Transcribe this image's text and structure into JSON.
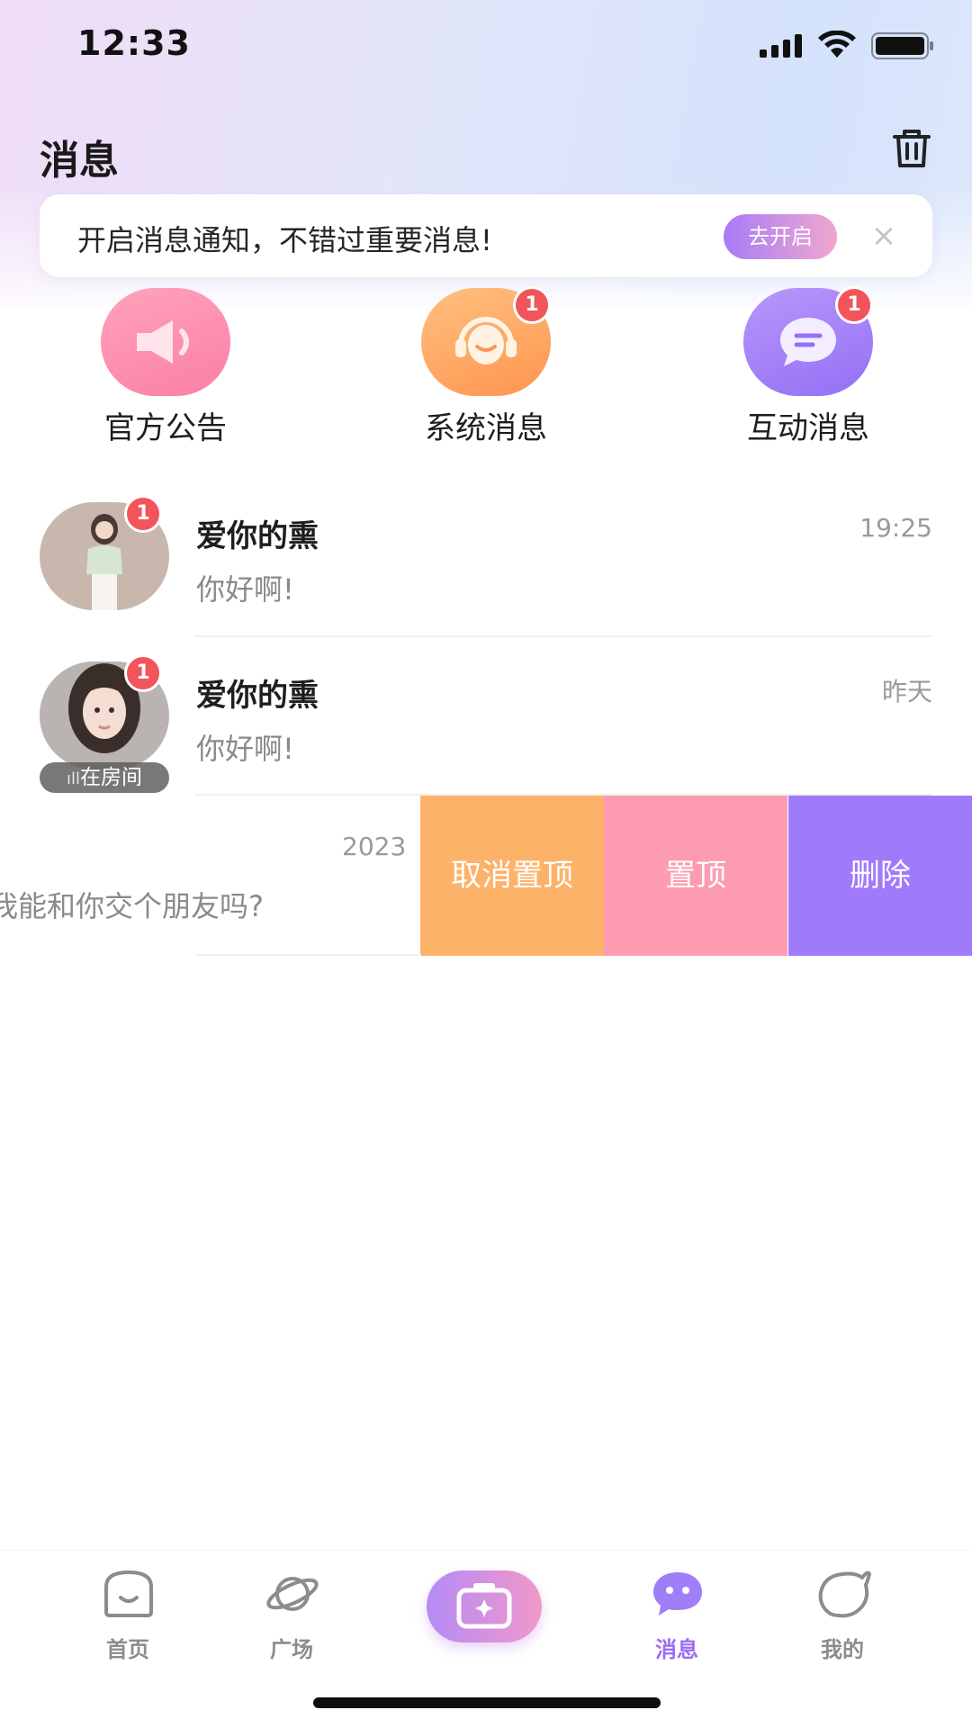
{
  "status_bar": {
    "time": "12:33"
  },
  "header": {
    "title": "消息"
  },
  "notification_banner": {
    "text": "开启消息通知，不错过重要消息!",
    "button_label": "去开启",
    "close_symbol": "×"
  },
  "quick_entries": [
    {
      "label": "官方公告",
      "icon": "megaphone-icon",
      "color": "#fd8fae",
      "badge": ""
    },
    {
      "label": "系统消息",
      "icon": "headset-icon",
      "color": "#fea463",
      "badge": "1"
    },
    {
      "label": "互动消息",
      "icon": "chat-bubble-icon",
      "color": "#a07ef7",
      "badge": "1"
    }
  ],
  "conversations": [
    {
      "name": "爱你的熏",
      "time": "19:25",
      "preview": "你好啊!",
      "badge": "1",
      "tag": ""
    },
    {
      "name": "爱你的熏",
      "time": "昨天",
      "preview": "你好啊!",
      "badge": "1",
      "tag": "在房间"
    }
  ],
  "swiped_conversation": {
    "time_partial": "2023",
    "preview_partial": "我能和你交个朋友吗?",
    "actions": [
      {
        "label": "取消置顶",
        "color": "#fdb26a"
      },
      {
        "label": "置顶",
        "color": "#fd9bb2"
      },
      {
        "label": "删除",
        "color": "#9f7bfb"
      }
    ]
  },
  "bottom_nav": {
    "items": [
      {
        "label": "首页",
        "icon": "home-face-icon",
        "active": false
      },
      {
        "label": "广场",
        "icon": "planet-icon",
        "active": false
      },
      {
        "label": "",
        "icon": "camera-icon",
        "active": false
      },
      {
        "label": "消息",
        "icon": "message-bubble-icon",
        "active": true
      },
      {
        "label": "我的",
        "icon": "profile-blob-icon",
        "active": false
      }
    ],
    "active_color": "#9c6cf6"
  }
}
